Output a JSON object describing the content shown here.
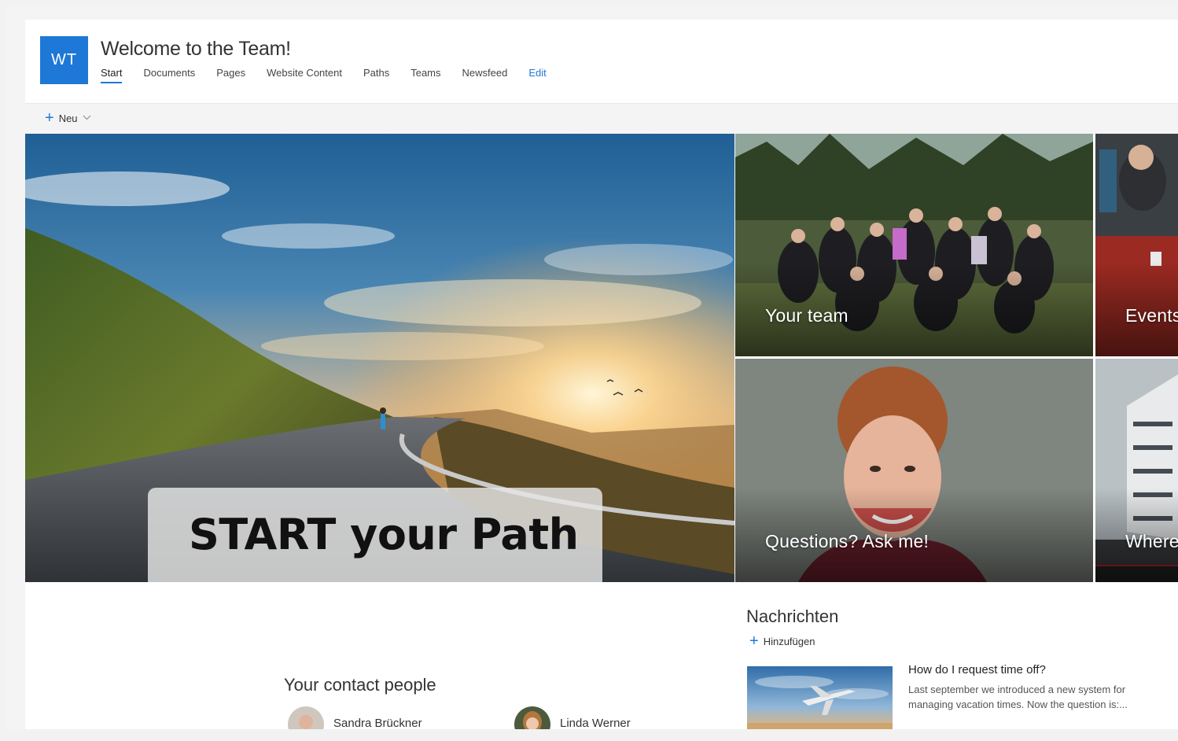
{
  "site": {
    "logo_initials": "WT",
    "title": "Welcome to the Team!"
  },
  "nav": {
    "items": [
      {
        "label": "Start",
        "active": true
      },
      {
        "label": "Documents"
      },
      {
        "label": "Pages"
      },
      {
        "label": "Website Content"
      },
      {
        "label": "Paths"
      },
      {
        "label": "Teams"
      },
      {
        "label": "Newsfeed"
      }
    ],
    "edit_label": "Edit"
  },
  "commandbar": {
    "new_label": "Neu",
    "new_icon": "plus-icon",
    "dropdown_icon": "chevron-down-icon"
  },
  "hero": {
    "main_text": "START your Path",
    "tiles": [
      {
        "label": "Your team"
      },
      {
        "label": "Events"
      },
      {
        "label": "Questions? Ask me!"
      },
      {
        "label": "Where"
      }
    ]
  },
  "news": {
    "title": "Nachrichten",
    "add_label": "Hinzufügen",
    "items": [
      {
        "headline": "How do I request time off?",
        "excerpt": "Last september we introduced a new system for managing vacation times. Now the question is:..."
      }
    ]
  },
  "contacts": {
    "title": "Your contact people",
    "people": [
      {
        "name": "Sandra Brückner"
      },
      {
        "name": "Linda Werner"
      }
    ]
  },
  "colors": {
    "accent": "#1e78d7",
    "page_background": "#f4f4f4"
  }
}
